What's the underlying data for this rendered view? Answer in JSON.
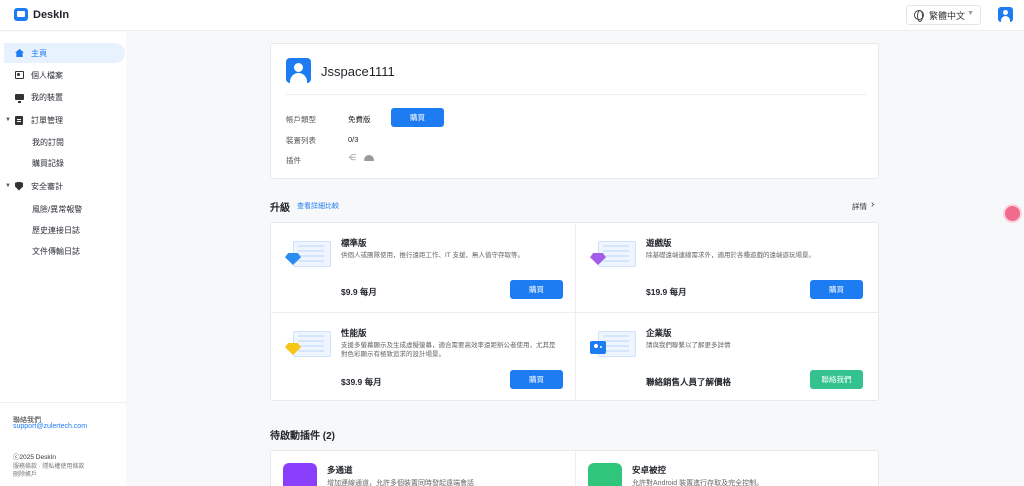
{
  "app": {
    "name": "DeskIn"
  },
  "header": {
    "language": "繁體中文"
  },
  "sidebar": {
    "items": [
      {
        "label": "主頁"
      },
      {
        "label": "個人檔案"
      },
      {
        "label": "我的裝置"
      },
      {
        "label": "訂單管理",
        "children": [
          {
            "label": "我的訂閱"
          },
          {
            "label": "購買記錄"
          }
        ]
      },
      {
        "label": "安全審計",
        "children": [
          {
            "label": "風險/異常報警"
          },
          {
            "label": "歷史連接日誌"
          },
          {
            "label": "文件傳輸日誌"
          }
        ]
      }
    ],
    "footer": {
      "contact_label": "聯絡我們",
      "email": "support@zulertech.com",
      "copyright": "ⓒ2025 DeskIn",
      "legal_line1": "服務條款 · 隱私權使用條款",
      "legal_line2": "刪除帳戶"
    }
  },
  "account": {
    "username": "Jsspace1111",
    "type_label": "帳戶類型",
    "type_value": "免費版",
    "buy_label": "購買",
    "devices_label": "裝置列表",
    "devices_value": "0/3",
    "plugins_label": "插件"
  },
  "upgrade": {
    "title": "升級",
    "compare_link": "查看詳細比較",
    "details_link": "詳情",
    "plans": [
      {
        "name": "標準版",
        "desc": "供個人或團隊使用，推行遠距工作、IT 支援、無人值守存取等。",
        "price": "$9.9 每月",
        "button": "購買",
        "gem_color": "#2d8cf0"
      },
      {
        "name": "遊戲版",
        "desc": "除基礎遠端連線需求外，適用於各種遊戲的遠端遊玩場景。",
        "price": "$19.9 每月",
        "button": "購買",
        "gem_color": "#a45de8"
      },
      {
        "name": "性能版",
        "desc": "支援多螢幕顯示及生成虛擬螢幕，適合需要高效率遠距辦公者使用，尤其是對色彩顯示有極致追求的設計場景。",
        "price": "$39.9 每月",
        "button": "購買",
        "gem_color": "#f5c518"
      },
      {
        "name": "企業版",
        "desc": "請與我們聯繫以了解更多詳情",
        "price": "聯絡銷售人員了解價格",
        "button": "聯絡我們"
      }
    ]
  },
  "plugins": {
    "title": "待啟動插件 (2)",
    "items": [
      {
        "name": "多通道",
        "desc": "增加連線通道，允許多個裝置同時發起遠端會話"
      },
      {
        "name": "安卓被控",
        "desc": "允許對Android 裝置進行存取及完全控制。"
      }
    ]
  }
}
